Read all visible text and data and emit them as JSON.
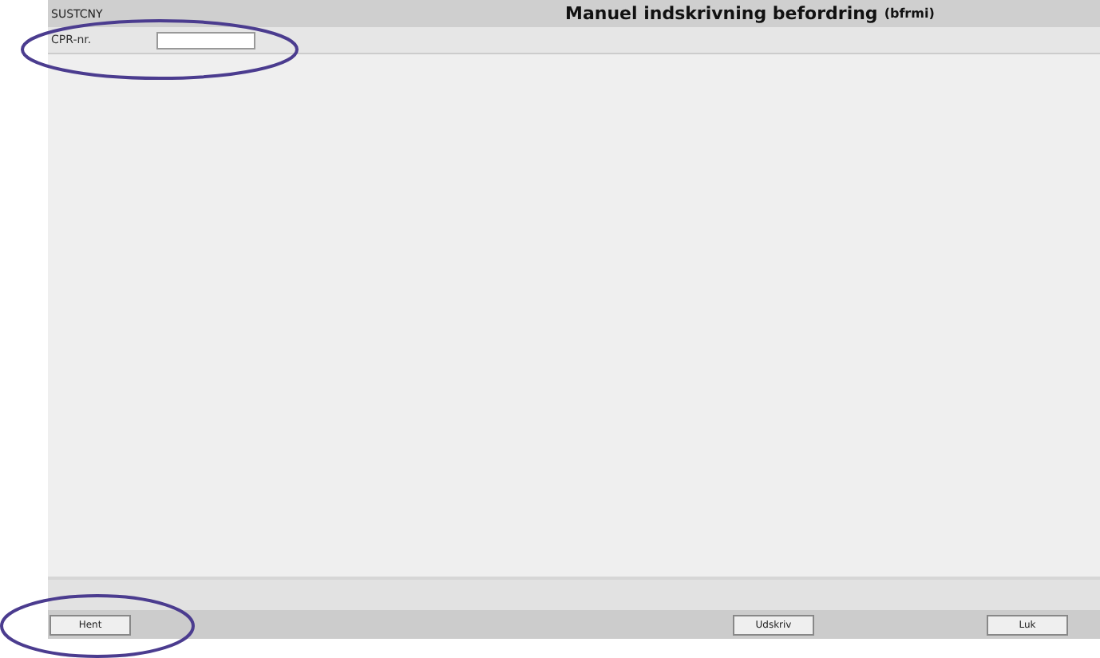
{
  "header": {
    "system": "SUSTCNY",
    "title": "Manuel indskrivning befordring",
    "code": "(bfrmi)"
  },
  "form": {
    "label": "CPR-nr."
  },
  "buttons": [
    {
      "label": "Hent"
    },
    {
      "label": "Udskriv"
    },
    {
      "label": "Luk"
    }
  ],
  "annotations": [
    {
      "kind": "ellipse"
    },
    {
      "kind": "ellipse"
    }
  ]
}
